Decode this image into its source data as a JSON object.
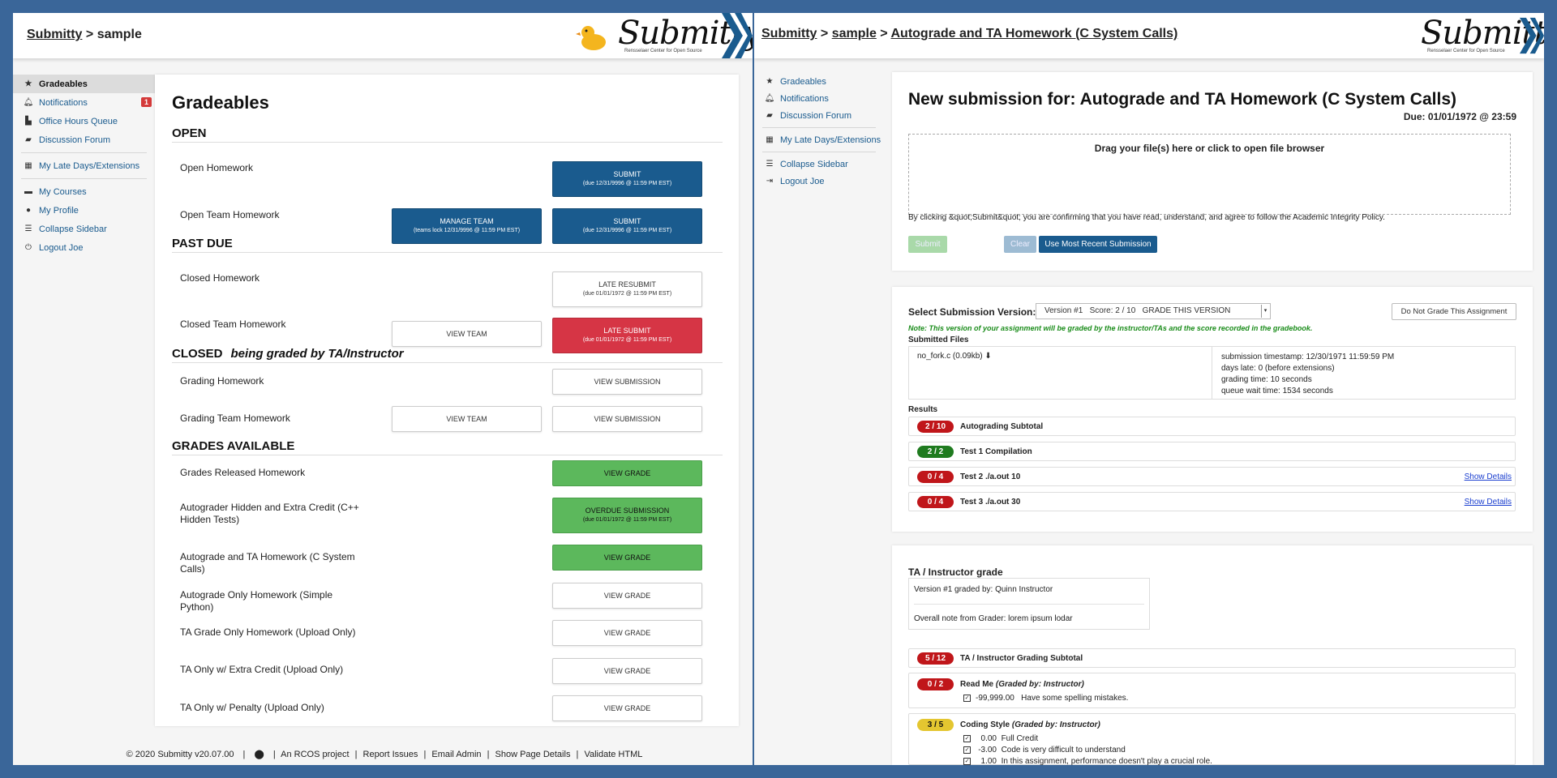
{
  "left": {
    "breadcrumb": {
      "root": "Submitty",
      "sep": ">",
      "course": "sample"
    },
    "logo": {
      "word": "Submitty",
      "sub": "Rensselaer Center for Open Source"
    },
    "sidebar": {
      "items": [
        {
          "label": "Gradeables",
          "icon": "star-icon"
        },
        {
          "label": "Notifications",
          "icon": "bell-icon",
          "badge": "1"
        },
        {
          "label": "Office Hours Queue",
          "icon": "user-queue-icon"
        },
        {
          "label": "Discussion Forum",
          "icon": "comments-icon"
        },
        {
          "label": "My Late Days/Extensions",
          "icon": "calendar-icon"
        },
        {
          "label": "My Courses",
          "icon": "folder-icon"
        },
        {
          "label": "My Profile",
          "icon": "user-icon"
        },
        {
          "label": "Collapse Sidebar",
          "icon": "bars-icon"
        },
        {
          "label": "Logout Joe",
          "icon": "power-icon"
        }
      ]
    },
    "title": "Gradeables",
    "sections": {
      "open": "OPEN",
      "past_due": "PAST DUE",
      "closed": "CLOSED",
      "closed_sub": "being graded by TA/Instructor",
      "grades": "GRADES AVAILABLE"
    },
    "rows": [
      {
        "name": "Open Homework",
        "b2": "SUBMIT",
        "b2s": "(due 12/31/9996 @ 11:59 PM EST)"
      },
      {
        "name": "Open Team Homework",
        "b1": "MANAGE TEAM",
        "b1s": "(teams lock 12/31/9996 @ 11:59 PM EST)",
        "b2": "SUBMIT",
        "b2s": "(due 12/31/9996 @ 11:59 PM EST)"
      },
      {
        "name": "Closed Homework",
        "b2": "LATE RESUBMIT",
        "b2s": "(due 01/01/1972 @ 11:59 PM EST)"
      },
      {
        "name": "Closed Team Homework",
        "b1": "VIEW TEAM",
        "b2": "LATE SUBMIT",
        "b2s": "(due 01/01/1972 @ 11:59 PM EST)"
      },
      {
        "name": "Grading Homework",
        "b2": "VIEW SUBMISSION"
      },
      {
        "name": "Grading Team Homework",
        "b1": "VIEW TEAM",
        "b2": "VIEW SUBMISSION"
      },
      {
        "name": "Grades Released Homework",
        "b2": "VIEW GRADE"
      },
      {
        "name": "Autograder Hidden and Extra Credit (C++ Hidden Tests)",
        "b2": "OVERDUE SUBMISSION",
        "b2s": "(due 01/01/1972 @ 11:59 PM EST)"
      },
      {
        "name": "Autograde and TA Homework (C System Calls)",
        "b2": "VIEW GRADE"
      },
      {
        "name": "Autograde Only Homework (Simple Python)",
        "b2": "VIEW GRADE"
      },
      {
        "name": "TA Grade Only Homework (Upload Only)",
        "b2": "VIEW GRADE"
      },
      {
        "name": "TA Only w/ Extra Credit (Upload Only)",
        "b2": "VIEW GRADE"
      },
      {
        "name": "TA Only w/ Penalty (Upload Only)",
        "b2": "VIEW GRADE"
      }
    ],
    "footer": {
      "copy": "© 2020 Submitty v20.07.00",
      "github": "github-icon",
      "rcos": "An RCOS project",
      "report": "Report Issues",
      "email": "Email Admin",
      "details": "Show Page Details",
      "validate": "Validate HTML",
      "sep": "|"
    }
  },
  "right": {
    "breadcrumb": {
      "root": "Submitty",
      "course": "sample",
      "page": "Autograde and TA Homework (C System Calls)",
      "sep": ">"
    },
    "logo": {
      "word": "Submitty",
      "sub": "Rensselaer Center for Open Source"
    },
    "sidebar": {
      "items": [
        {
          "label": "Gradeables",
          "icon": "star-icon"
        },
        {
          "label": "Notifications",
          "icon": "bell-icon"
        },
        {
          "label": "Discussion Forum",
          "icon": "comments-icon"
        },
        {
          "label": "My Late Days/Extensions",
          "icon": "calendar-icon"
        },
        {
          "label": "Collapse Sidebar",
          "icon": "bars-icon"
        },
        {
          "label": "Logout Joe",
          "icon": "sign-out-icon"
        }
      ]
    },
    "submission": {
      "title": "New submission for: Autograde and TA Homework (C System Calls)",
      "due": "Due: 01/01/1972 @ 23:59",
      "drop": "Drag your file(s) here or click to open file browser",
      "integrity": "By clicking &quot;Submit&quot; you are confirming that you have read, understand, and agree to follow the Academic Integrity Policy.",
      "submit": "Submit",
      "clear": "Clear",
      "recent": "Use Most Recent Submission"
    },
    "version": {
      "label": "Select Submission Version:",
      "selected": "Version #1   Score: 2 / 10   GRADE THIS VERSION",
      "no_grade": "Do Not Grade This Assignment",
      "note": "Note: This version of your assignment will be graded by the instructor/TAs and the score recorded in the gradebook.",
      "files_label": "Submitted Files",
      "file": "no_fork.c (0.09kb)",
      "timestamp": "submission timestamp: 12/30/1971 11:59:59 PM",
      "days_late": "days late: 0 (before extensions)",
      "grading_time": "grading time: 10 seconds",
      "queue_time": "queue wait time: 1534 seconds",
      "results_label": "Results",
      "results": [
        {
          "score": "2 / 10",
          "label": "Autograding Subtotal",
          "color": "#c0161a"
        },
        {
          "score": "2 / 2",
          "label": "Test 1 Compilation",
          "color": "#1f7b1f"
        },
        {
          "score": "0 / 4",
          "label": "Test 2 ./a.out 10",
          "details": "Show Details",
          "color": "#c0161a"
        },
        {
          "score": "0 / 4",
          "label": "Test 3 ./a.out 30",
          "details": "Show Details",
          "color": "#c0161a"
        }
      ]
    },
    "ta": {
      "title": "TA / Instructor grade",
      "graded_by": "Version #1 graded by: Quinn Instructor",
      "note": "Overall note from Grader: lorem ipsum lodar",
      "subtotal_score": "5 / 12",
      "subtotal_label": "TA / Instructor Grading Subtotal",
      "read_score": "0 / 2",
      "read_label": "Read Me",
      "read_by": "(Graded by: Instructor)",
      "read_items": [
        {
          "pts": "-99,999.00",
          "text": "Have some spelling mistakes."
        }
      ],
      "style_score": "3 / 5",
      "style_label": "Coding Style",
      "style_by": "(Graded by: Instructor)",
      "style_items": [
        {
          "pts": "0.00",
          "text": "Full Credit"
        },
        {
          "pts": "-3.00",
          "text": "Code is very difficult to understand"
        },
        {
          "pts": "1.00",
          "text": "In this assignment, performance doesn't play a crucial role."
        }
      ]
    }
  }
}
